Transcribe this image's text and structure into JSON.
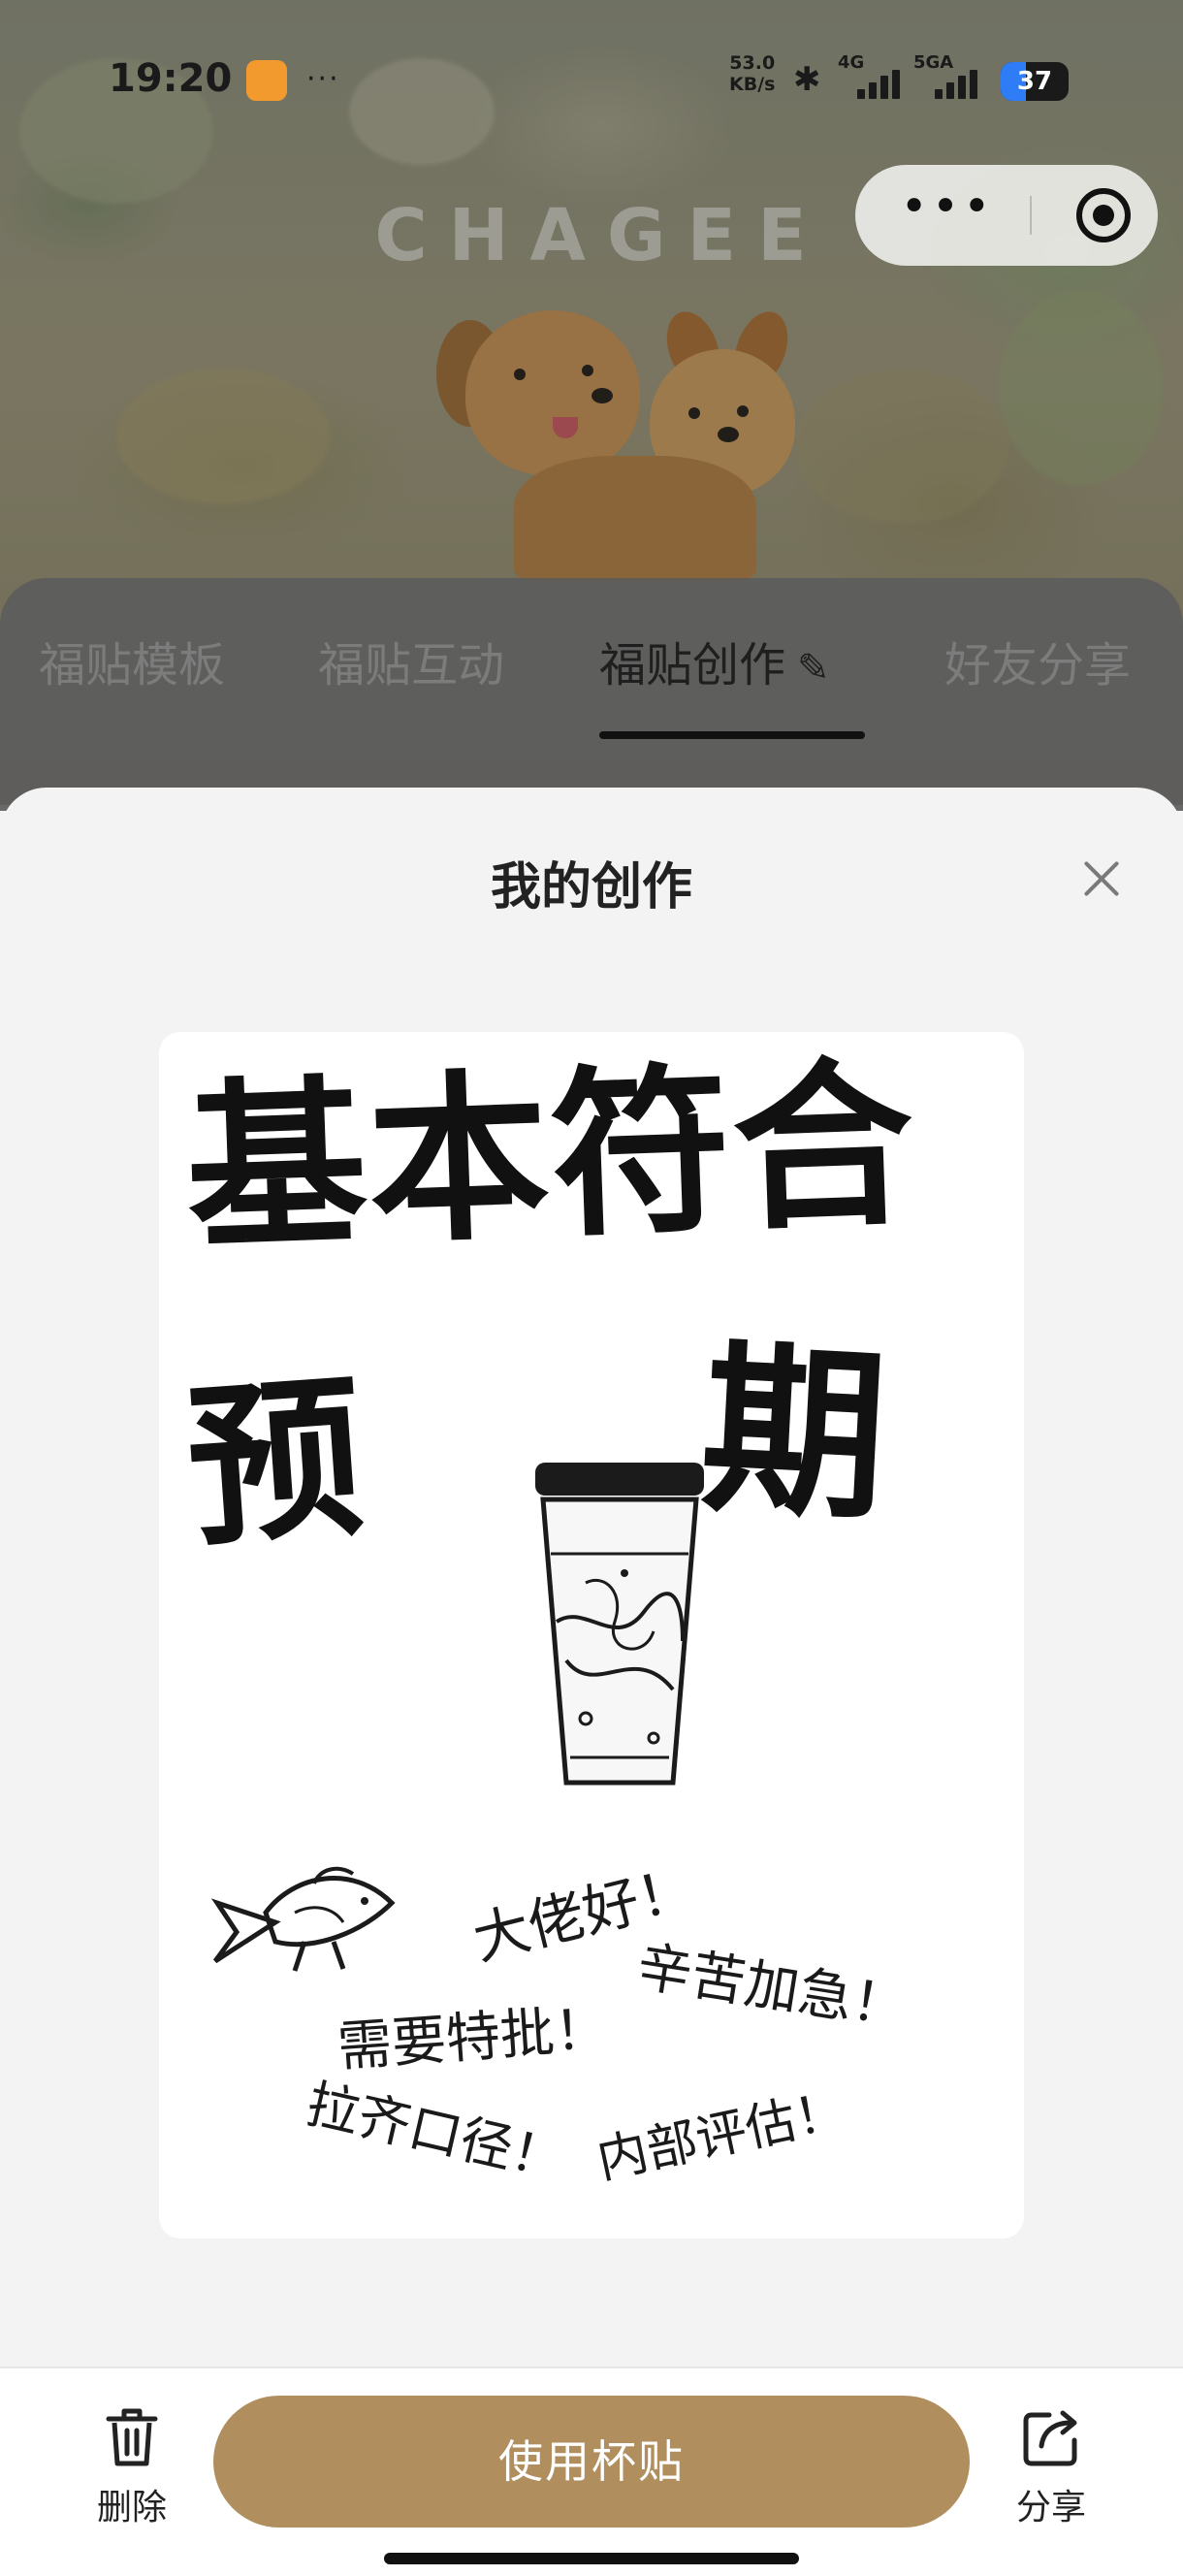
{
  "status_bar": {
    "time": "19:20",
    "overflow": "···",
    "net_speed_value": "53.0",
    "net_speed_unit": "KB/s",
    "signal_1_label": "4G",
    "signal_2_label": "5GA",
    "battery_level": "37",
    "icons": [
      "app-badge-icon",
      "bluetooth-icon",
      "signal-icon",
      "wifi-icon",
      "battery-icon"
    ]
  },
  "header": {
    "brand": "CHAGEE",
    "capsule": {
      "more_label": "•••",
      "icons": [
        "more-icon",
        "close-miniprogram-icon"
      ]
    }
  },
  "tabs": [
    {
      "label": "福贴模板",
      "active": false
    },
    {
      "label": "福贴互动",
      "active": false
    },
    {
      "label": "福贴创作",
      "active": true,
      "icon": "pen-icon"
    },
    {
      "label": "好友分享",
      "active": false
    }
  ],
  "sheet": {
    "title": "我的创作",
    "close_icon": "close-icon"
  },
  "artwork": {
    "line1": "基本符合",
    "line2_left": "预",
    "line2_right": "期",
    "scrawls": [
      "大佬好！",
      "辛苦加急！",
      "需要特批！",
      "拉齐口径！",
      "内部评估！"
    ],
    "icons": [
      "tea-cup-icon",
      "fish-icon"
    ]
  },
  "actions": {
    "delete_label": "删除",
    "use_label": "使用杯贴",
    "share_label": "分享",
    "icons": [
      "trash-icon",
      "share-icon"
    ]
  },
  "colors": {
    "accent": "#b08e5e",
    "sheet_bg": "#f3f3f3",
    "tab_bar_bg": "#5c5c5c",
    "battery_fill": "#2f7df6"
  }
}
